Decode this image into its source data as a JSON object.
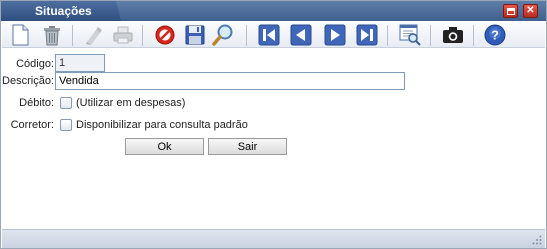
{
  "window": {
    "title": "Situações"
  },
  "toolbar": {
    "buttons": [
      {
        "name": "new-document-icon",
        "enabled": true
      },
      {
        "name": "trash-icon",
        "enabled": true
      },
      {
        "name": "edit-disabled-icon",
        "enabled": false
      },
      {
        "name": "print-disabled-icon",
        "enabled": false
      },
      {
        "name": "cancel-icon",
        "enabled": true
      },
      {
        "name": "save-disk-icon",
        "enabled": true
      },
      {
        "name": "search-magnifier-icon",
        "enabled": true
      },
      {
        "name": "first-record-icon",
        "enabled": true
      },
      {
        "name": "previous-record-icon",
        "enabled": true
      },
      {
        "name": "next-record-icon",
        "enabled": true
      },
      {
        "name": "last-record-icon",
        "enabled": true
      },
      {
        "name": "preview-icon",
        "enabled": true
      },
      {
        "name": "camera-icon",
        "enabled": true
      },
      {
        "name": "help-icon",
        "enabled": true
      }
    ]
  },
  "form": {
    "codigo": {
      "label": "Código:",
      "value": "1"
    },
    "descricao": {
      "label": "Descrição:",
      "value": "Vendida"
    },
    "debito": {
      "label": "Débito:",
      "checkbox_label": "(Utilizar em despesas)",
      "checked": false
    },
    "corretor": {
      "label": "Corretor:",
      "checkbox_label": "Disponibilizar para consulta padrão",
      "checked": false
    },
    "ok_label": "Ok",
    "sair_label": "Sair"
  },
  "colors": {
    "titlebar": "#4a6a99",
    "accent_blue": "#3b63b5",
    "close_red": "#c9352a"
  }
}
